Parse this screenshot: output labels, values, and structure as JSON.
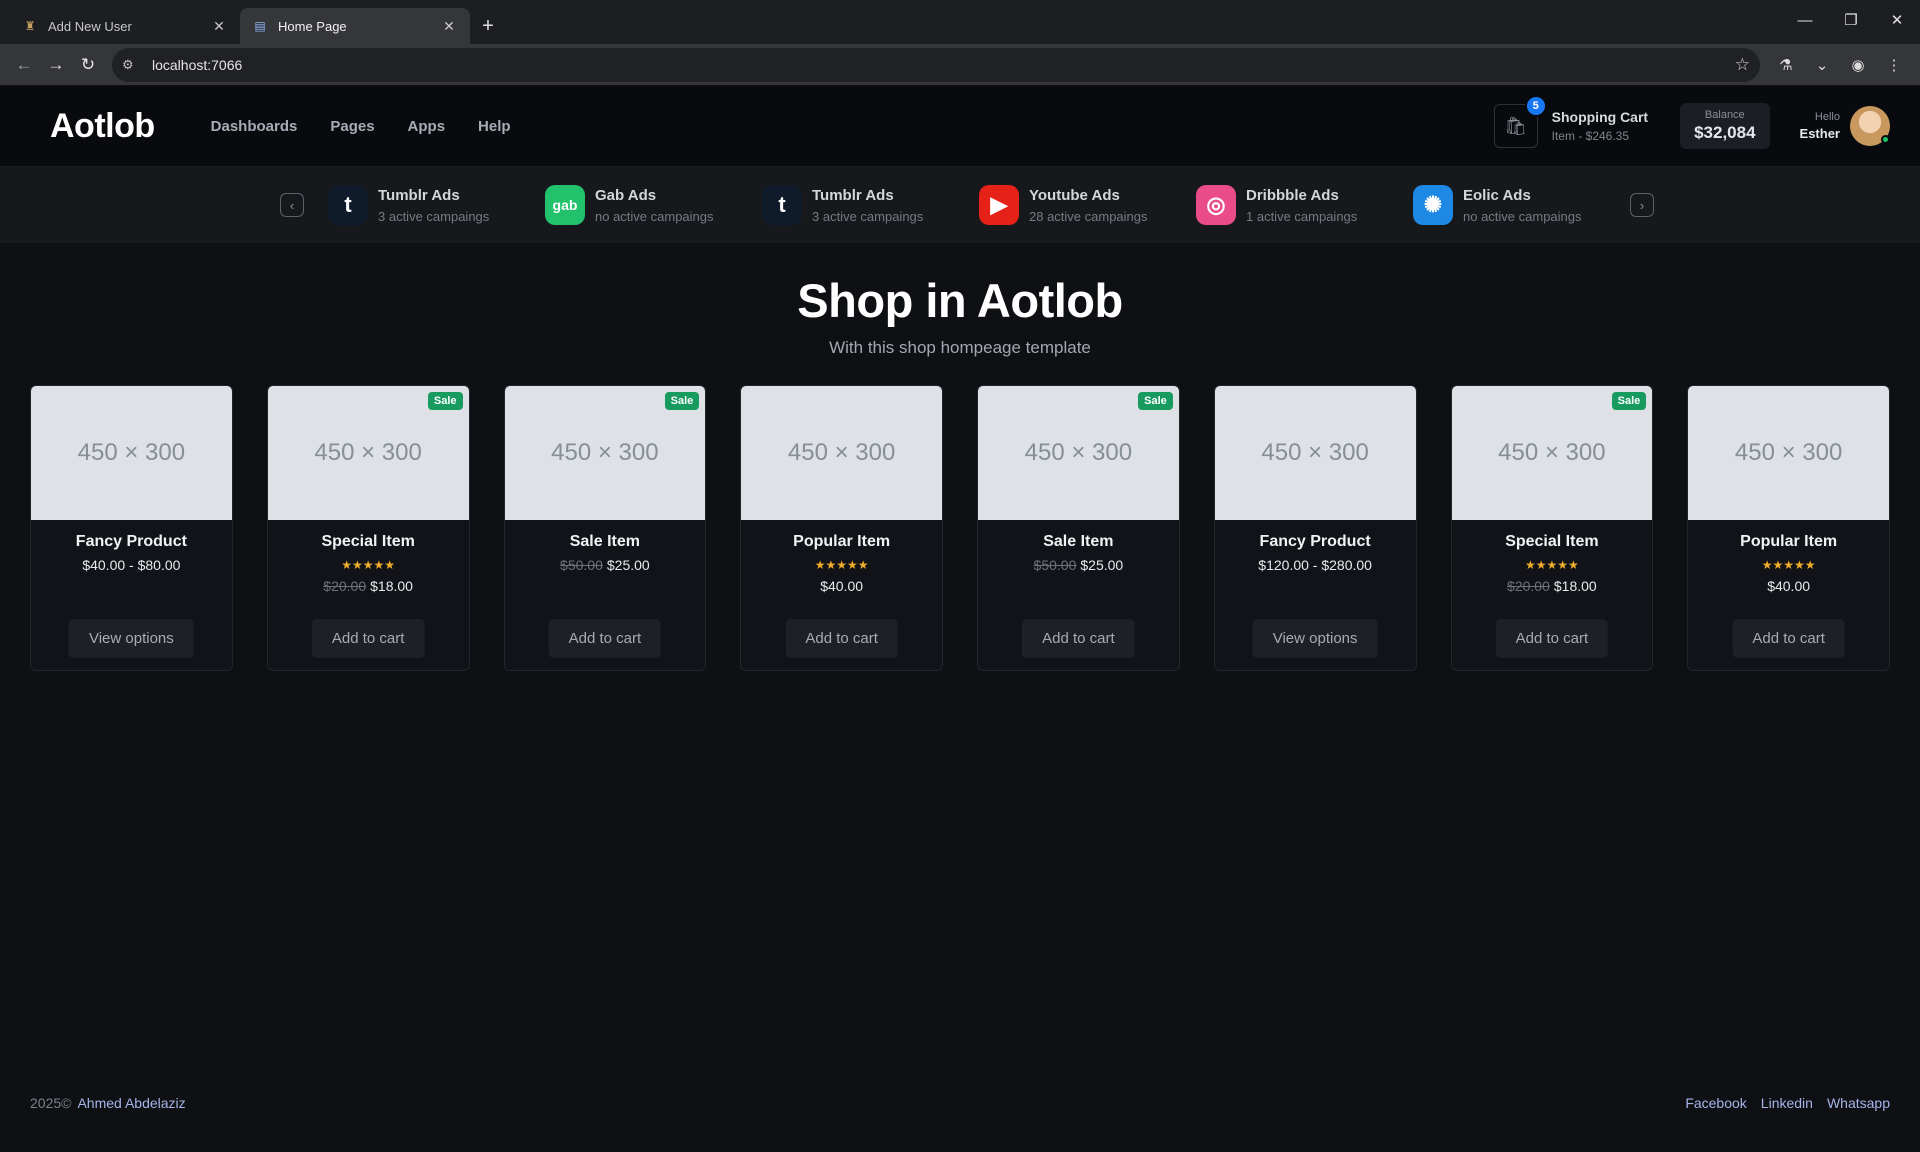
{
  "browser": {
    "tabs": [
      {
        "title": "Add New User",
        "icon": "app-icon",
        "active": false
      },
      {
        "title": "Home Page",
        "icon": "page-icon",
        "active": true
      }
    ],
    "url": "localhost:7066"
  },
  "header": {
    "logo": "Aotlob",
    "nav": [
      "Dashboards",
      "Pages",
      "Apps",
      "Help"
    ],
    "cart": {
      "badge": "5",
      "title": "Shopping Cart",
      "subtitle": "Item - $246.35"
    },
    "balance": {
      "label": "Balance",
      "value": "$32,084"
    },
    "user": {
      "greeting": "Hello",
      "name": "Esther"
    }
  },
  "ads": [
    {
      "name": "Tumblr Ads",
      "campaigns": "3 active campaings",
      "icon": "tumblr-icon",
      "color": "#0f1a2b",
      "glyph": "t"
    },
    {
      "name": "Gab Ads",
      "campaigns": "no active campaings",
      "icon": "gab-icon",
      "color": "#21c26b",
      "glyph": "gab"
    },
    {
      "name": "Tumblr Ads",
      "campaigns": "3 active campaings",
      "icon": "tumblr-icon",
      "color": "#0f1a2b",
      "glyph": "t"
    },
    {
      "name": "Youtube Ads",
      "campaigns": "28 active campaings",
      "icon": "youtube-icon",
      "color": "#e62117",
      "glyph": "▶"
    },
    {
      "name": "Dribbble Ads",
      "campaigns": "1 active campaings",
      "icon": "dribbble-icon",
      "color": "#ea4c89",
      "glyph": "◎"
    },
    {
      "name": "Eolic Ads",
      "campaigns": "no active campaings",
      "icon": "eolic-icon",
      "color": "#1e88e5",
      "glyph": "✺"
    }
  ],
  "hero": {
    "title": "Shop in Aotlob",
    "subtitle": "With this shop hompeage template"
  },
  "products": [
    {
      "image": "450 × 300",
      "name": "Fancy Product",
      "sale": false,
      "stars": false,
      "old_price": "",
      "price": "$40.00 - $80.00",
      "button": "View options"
    },
    {
      "image": "450 × 300",
      "name": "Special Item",
      "sale": true,
      "stars": true,
      "old_price": "$20.00",
      "price": "$18.00",
      "button": "Add to cart"
    },
    {
      "image": "450 × 300",
      "name": "Sale Item",
      "sale": true,
      "stars": false,
      "old_price": "$50.00",
      "price": "$25.00",
      "button": "Add to cart"
    },
    {
      "image": "450 × 300",
      "name": "Popular Item",
      "sale": false,
      "stars": true,
      "old_price": "",
      "price": "$40.00",
      "button": "Add to cart"
    },
    {
      "image": "450 × 300",
      "name": "Sale Item",
      "sale": true,
      "stars": false,
      "old_price": "$50.00",
      "price": "$25.00",
      "button": "Add to cart"
    },
    {
      "image": "450 × 300",
      "name": "Fancy Product",
      "sale": false,
      "stars": false,
      "old_price": "",
      "price": "$120.00 - $280.00",
      "button": "View options"
    },
    {
      "image": "450 × 300",
      "name": "Special Item",
      "sale": true,
      "stars": true,
      "old_price": "$20.00",
      "price": "$18.00",
      "button": "Add to cart"
    },
    {
      "image": "450 × 300",
      "name": "Popular Item",
      "sale": false,
      "stars": true,
      "old_price": "",
      "price": "$40.00",
      "button": "Add to cart"
    }
  ],
  "sale_label": "Sale",
  "stars_text": "★★★★★",
  "footer": {
    "year": "2025©",
    "author": "Ahmed Abdelaziz",
    "links": [
      "Facebook",
      "Linkedin",
      "Whatsapp"
    ]
  }
}
